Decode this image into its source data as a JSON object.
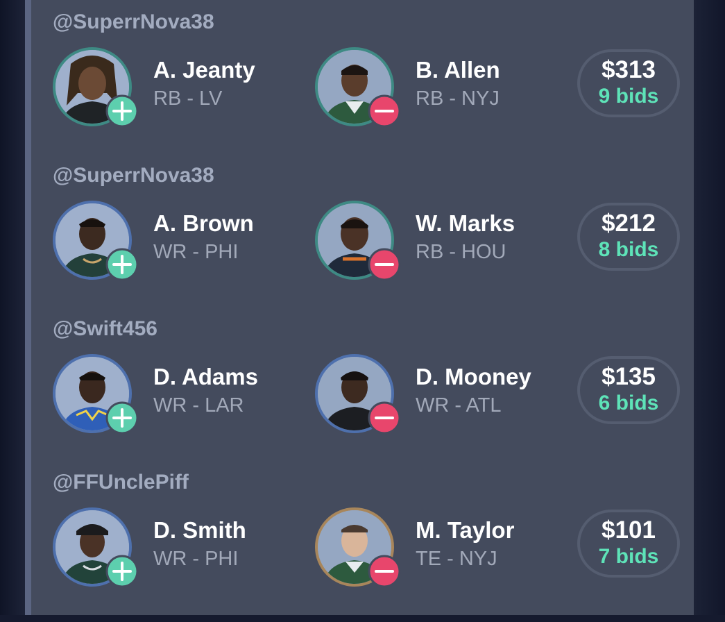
{
  "colors": {
    "add": "#5dcfae",
    "remove": "#e8466c",
    "bids": "#5ee3b8",
    "border_teal": "#3e8a84",
    "border_blue": "#4e70ad",
    "border_gold": "#a8865b"
  },
  "trades": [
    {
      "handle": "@SuperrNova38",
      "add": {
        "name": "A. Jeanty",
        "position": "RB - LV",
        "icon": "add-icon"
      },
      "drop": {
        "name": "B. Allen",
        "position": "RB - NYJ",
        "icon": "remove-icon"
      },
      "amount": "$313",
      "bids": "9 bids"
    },
    {
      "handle": "@SuperrNova38",
      "add": {
        "name": "A. Brown",
        "position": "WR - PHI",
        "icon": "add-icon"
      },
      "drop": {
        "name": "W. Marks",
        "position": "RB - HOU",
        "icon": "remove-icon"
      },
      "amount": "$212",
      "bids": "8 bids"
    },
    {
      "handle": "@Swift456",
      "add": {
        "name": "D. Adams",
        "position": "WR - LAR",
        "icon": "add-icon"
      },
      "drop": {
        "name": "D. Mooney",
        "position": "WR - ATL",
        "icon": "remove-icon"
      },
      "amount": "$135",
      "bids": "6 bids"
    },
    {
      "handle": "@FFUnclePiff",
      "add": {
        "name": "D. Smith",
        "position": "WR - PHI",
        "icon": "add-icon"
      },
      "drop": {
        "name": "M. Taylor",
        "position": "TE - NYJ",
        "icon": "remove-icon"
      },
      "amount": "$101",
      "bids": "7 bids"
    }
  ]
}
